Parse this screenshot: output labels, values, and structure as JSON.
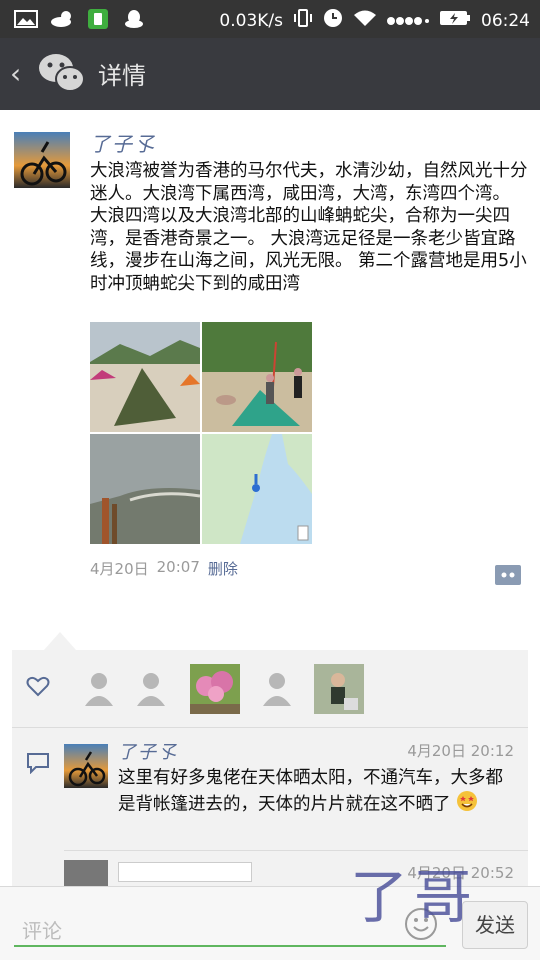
{
  "status_bar": {
    "network_speed": "0.03K/s",
    "time": "06:24",
    "icons": [
      "gallery-icon",
      "weather-icon",
      "battery-saver-icon",
      "qq-icon",
      "vibrate-icon",
      "alarm-icon",
      "wifi-icon",
      "signal-icon",
      "battery-icon"
    ]
  },
  "nav": {
    "title": "详情",
    "icons": [
      "back-chevron-icon",
      "wechat-icon"
    ]
  },
  "post": {
    "username": "了子孓",
    "text": "大浪湾被誉为香港的马尔代夫，水清沙幼，自然风光十分迷人。大浪湾下属西湾，咸田湾，大湾，东湾四个湾。 大浪四湾以及大浪湾北部的山峰蚺蛇尖，合称为一尖四湾，是香港奇景之一。 大浪湾远足径是一条老少皆宜路线，漫步在山海之间，风光无限。 第二个露营地是用5小时冲顶蚺蛇尖下到的咸田湾",
    "photos": [
      "beach-tents-photo",
      "camp-people-photo",
      "misty-coast-photo",
      "map-photo"
    ],
    "date": "4月20日",
    "time": "20:07",
    "delete_label": "删除"
  },
  "likes": {
    "count_shown": 5
  },
  "comments": [
    {
      "username": "了子孓",
      "date": "4月20日",
      "time": "20:12",
      "text": "这里有好多鬼佬在天体晒太阳，不通汽车，大多都是背帐篷进去的，天体的片片就在这不晒了",
      "emoji": "star-struck-emoji"
    },
    {
      "username": "",
      "date": "4月20日",
      "time": "20:52"
    }
  ],
  "input": {
    "placeholder": "评论",
    "send_label": "发送"
  },
  "watermark": "了哥",
  "colors": {
    "nav_bg": "#393a3f",
    "link_blue": "#576b95",
    "input_green": "#5fb65f"
  }
}
